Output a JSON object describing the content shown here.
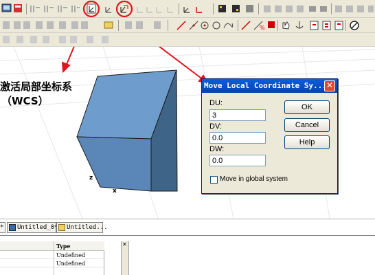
{
  "annotation": {
    "line1": "激活局部坐标系",
    "line2": "（WCS）"
  },
  "dialog": {
    "title": "Move Local Coordinate Sy...",
    "close_label": "✕",
    "fields": [
      {
        "label": "DU:",
        "value": "3"
      },
      {
        "label": "DV:",
        "value": "0.0"
      },
      {
        "label": "DW:",
        "value": "0.0"
      }
    ],
    "buttons": {
      "ok": "OK",
      "cancel": "Cancel",
      "help": "Help"
    },
    "checkbox_label": "Move in global system",
    "checkbox_checked": false
  },
  "axes": {
    "z": "z",
    "x": "x"
  },
  "tabs": [
    {
      "label": "Untitled_0*"
    },
    {
      "label": "Untitled..."
    }
  ],
  "tab_stub": "*",
  "table": {
    "header": "Type",
    "rows": [
      "Undefined",
      "Undefined"
    ]
  },
  "splitter_glyph": "✕",
  "colors": {
    "highlight": "#e0141e",
    "cube_front": "#5b87b8",
    "cube_top": "#6e9ccc",
    "cube_right": "#3e6488",
    "titlebar": "#0a5fd8"
  },
  "icons": {
    "highlighted": [
      "activate-wcs-icon",
      "move-wcs-icon"
    ]
  }
}
